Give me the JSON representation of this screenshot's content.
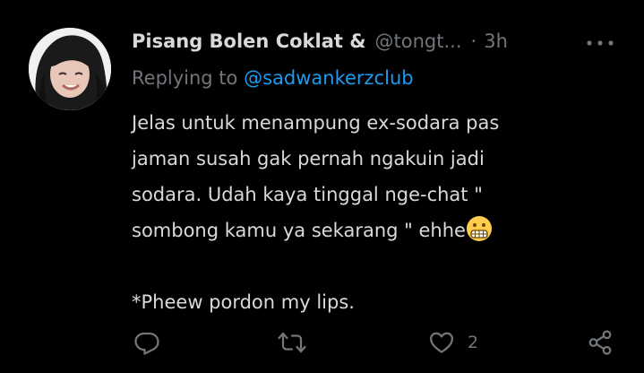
{
  "tweet": {
    "author_name": "Pisang Bolen Coklat &",
    "author_handle": "@tongt...",
    "separator": "·",
    "time": "3h",
    "replying_prefix": "Replying to ",
    "replying_to": "@sadwankerzclub",
    "lines": [
      "Jelas untuk menampung ex-sodara pas",
      "jaman susah gak pernah ngakuin jadi",
      "sodara. Udah kaya tinggal nge-chat \"",
      "sombong kamu ya sekarang \" ehhe",
      "",
      "*Pheew pordon my lips."
    ],
    "emoji": "grimacing-face-emoji",
    "avatar": "profile-photo-avatar"
  },
  "actions": {
    "reply_icon": "reply-icon",
    "retweet_icon": "retweet-icon",
    "like_icon": "heart-icon",
    "like_count": "2",
    "share_icon": "share-icon",
    "more_icon": "more-options-icon"
  },
  "colors": {
    "background": "#000000",
    "text": "#d9d9d9",
    "muted": "#71767b",
    "link": "#1d9bf0"
  }
}
